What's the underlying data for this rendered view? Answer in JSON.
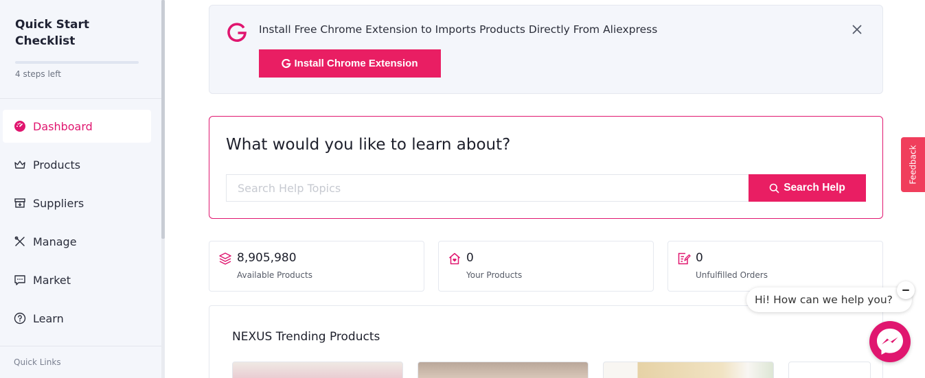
{
  "sidebar": {
    "checklist_title": "Quick Start Checklist",
    "checklist_sub": "4 steps left",
    "items": [
      {
        "label": "Dashboard",
        "icon": "gauge-icon",
        "active": true
      },
      {
        "label": "Products",
        "icon": "crown-icon",
        "active": false
      },
      {
        "label": "Suppliers",
        "icon": "archive-download-icon",
        "active": false
      },
      {
        "label": "Manage",
        "icon": "tools-icon",
        "active": false
      },
      {
        "label": "Market",
        "icon": "chat-dots-icon",
        "active": false
      },
      {
        "label": "Learn",
        "icon": "question-circle-icon",
        "active": false
      }
    ],
    "quick_links": "Quick Links"
  },
  "banner": {
    "text": "Install Free Chrome Extension to Imports Products Directly From Aliexpress",
    "button_label": "Install Chrome Extension"
  },
  "learn": {
    "title": "What would you like to learn about?",
    "search_placeholder": "Search Help Topics",
    "search_button": "Search Help"
  },
  "stats": [
    {
      "value": "8,905,980",
      "label": "Available Products",
      "icon": "layers-icon"
    },
    {
      "value": "0",
      "label": "Your Products",
      "icon": "home-heart-icon"
    },
    {
      "value": "0",
      "label": "Unfulfilled Orders",
      "icon": "edit-list-icon"
    }
  ],
  "trending": {
    "title": "NEXUS Trending Products"
  },
  "feedback": "Feedback",
  "chat": {
    "greeting": "Hi! How can we help you?"
  },
  "colors": {
    "accent": "#e91e63",
    "feedback": "#f03e5c"
  }
}
